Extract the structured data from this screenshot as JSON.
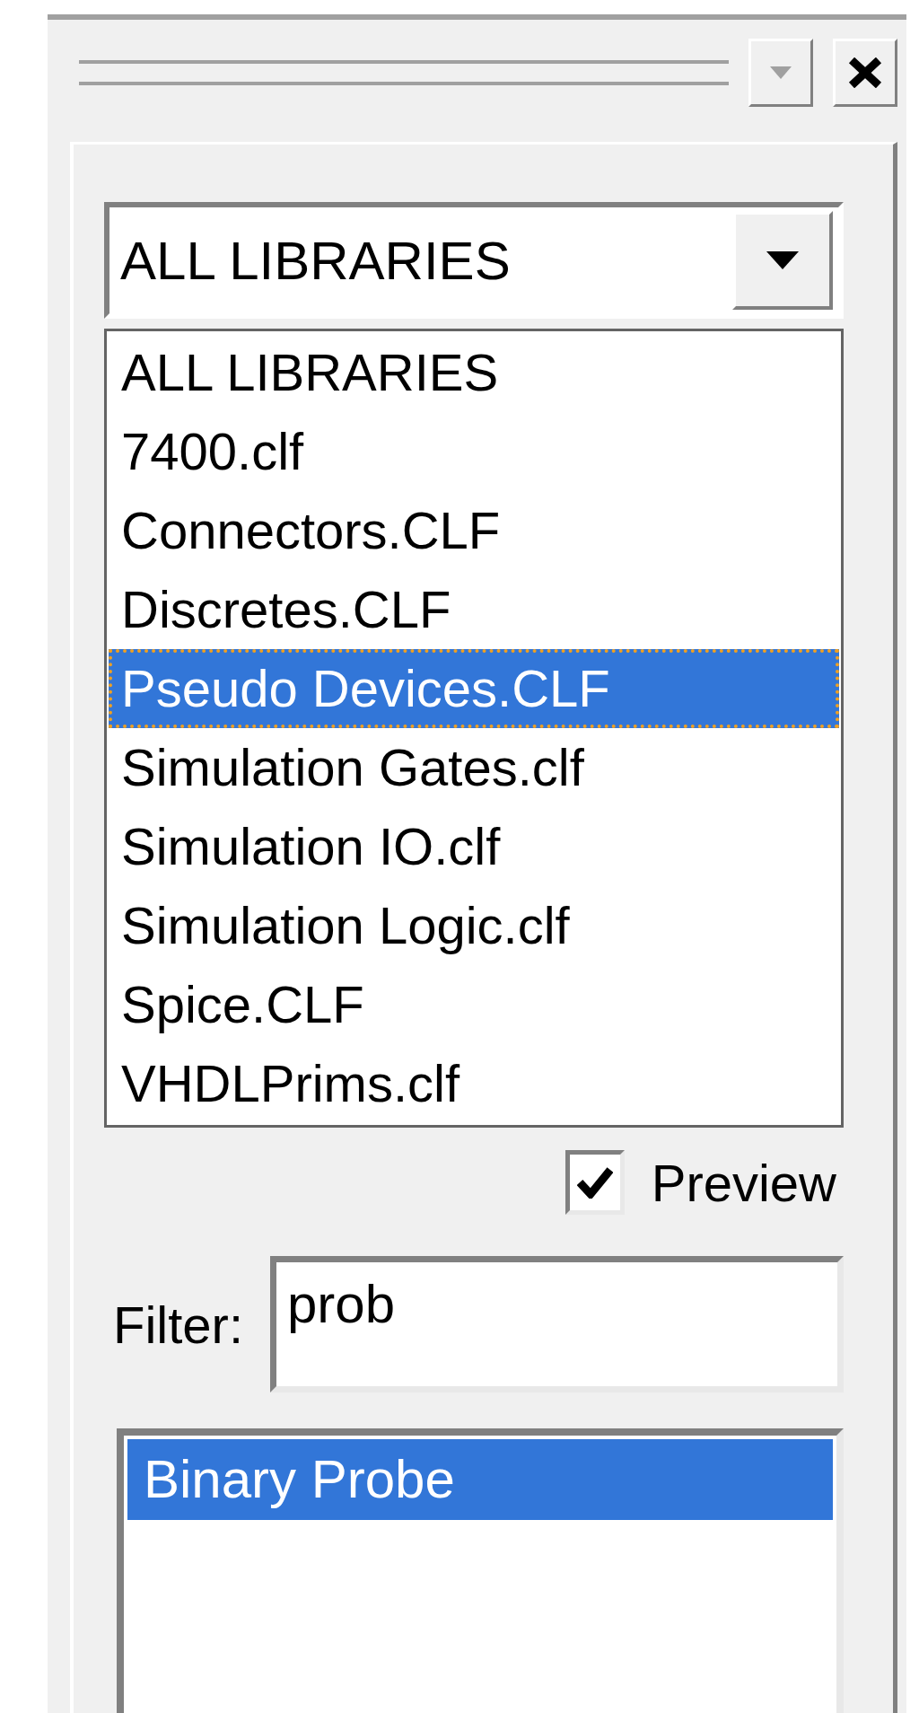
{
  "combo": {
    "value": "ALL LIBRARIES",
    "expanded": true
  },
  "dropdown_options": [
    {
      "label": "ALL LIBRARIES",
      "selected": false
    },
    {
      "label": "7400.clf",
      "selected": false
    },
    {
      "label": "Connectors.CLF",
      "selected": false
    },
    {
      "label": "Discretes.CLF",
      "selected": false
    },
    {
      "label": "Pseudo Devices.CLF",
      "selected": true
    },
    {
      "label": "Simulation Gates.clf",
      "selected": false
    },
    {
      "label": "Simulation IO.clf",
      "selected": false
    },
    {
      "label": "Simulation Logic.clf",
      "selected": false
    },
    {
      "label": "Spice.CLF",
      "selected": false
    },
    {
      "label": "VHDLPrims.clf",
      "selected": false
    }
  ],
  "preview": {
    "label": "Preview",
    "checked": true
  },
  "filter": {
    "label": "Filter:",
    "value": "prob"
  },
  "results": [
    {
      "label": "Binary Probe",
      "selected": true
    }
  ]
}
